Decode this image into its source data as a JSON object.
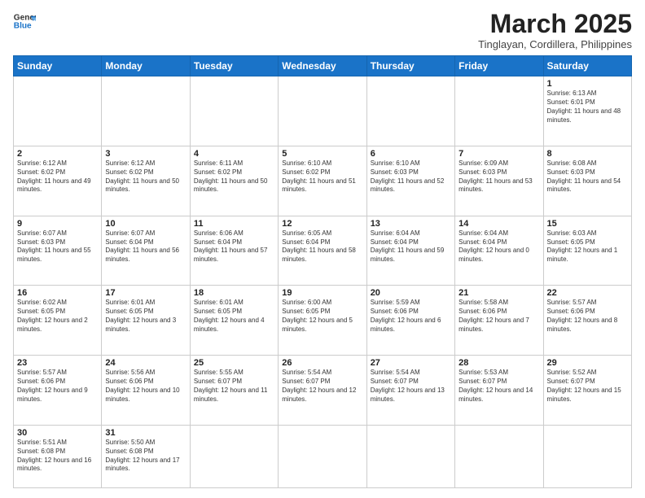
{
  "header": {
    "logo_general": "General",
    "logo_blue": "Blue",
    "title": "March 2025",
    "subtitle": "Tinglayan, Cordillera, Philippines"
  },
  "weekdays": [
    "Sunday",
    "Monday",
    "Tuesday",
    "Wednesday",
    "Thursday",
    "Friday",
    "Saturday"
  ],
  "weeks": [
    [
      {
        "day": "",
        "empty": true
      },
      {
        "day": "",
        "empty": true
      },
      {
        "day": "",
        "empty": true
      },
      {
        "day": "",
        "empty": true
      },
      {
        "day": "",
        "empty": true
      },
      {
        "day": "",
        "empty": true
      },
      {
        "day": "1",
        "rise": "6:13 AM",
        "set": "6:01 PM",
        "daylight": "11 hours and 48 minutes."
      }
    ],
    [
      {
        "day": "2",
        "rise": "6:12 AM",
        "set": "6:02 PM",
        "daylight": "11 hours and 49 minutes."
      },
      {
        "day": "3",
        "rise": "6:12 AM",
        "set": "6:02 PM",
        "daylight": "11 hours and 50 minutes."
      },
      {
        "day": "4",
        "rise": "6:11 AM",
        "set": "6:02 PM",
        "daylight": "11 hours and 50 minutes."
      },
      {
        "day": "5",
        "rise": "6:10 AM",
        "set": "6:02 PM",
        "daylight": "11 hours and 51 minutes."
      },
      {
        "day": "6",
        "rise": "6:10 AM",
        "set": "6:03 PM",
        "daylight": "11 hours and 52 minutes."
      },
      {
        "day": "7",
        "rise": "6:09 AM",
        "set": "6:03 PM",
        "daylight": "11 hours and 53 minutes."
      },
      {
        "day": "8",
        "rise": "6:08 AM",
        "set": "6:03 PM",
        "daylight": "11 hours and 54 minutes."
      }
    ],
    [
      {
        "day": "9",
        "rise": "6:07 AM",
        "set": "6:03 PM",
        "daylight": "11 hours and 55 minutes."
      },
      {
        "day": "10",
        "rise": "6:07 AM",
        "set": "6:04 PM",
        "daylight": "11 hours and 56 minutes."
      },
      {
        "day": "11",
        "rise": "6:06 AM",
        "set": "6:04 PM",
        "daylight": "11 hours and 57 minutes."
      },
      {
        "day": "12",
        "rise": "6:05 AM",
        "set": "6:04 PM",
        "daylight": "11 hours and 58 minutes."
      },
      {
        "day": "13",
        "rise": "6:04 AM",
        "set": "6:04 PM",
        "daylight": "11 hours and 59 minutes."
      },
      {
        "day": "14",
        "rise": "6:04 AM",
        "set": "6:04 PM",
        "daylight": "12 hours and 0 minutes."
      },
      {
        "day": "15",
        "rise": "6:03 AM",
        "set": "6:05 PM",
        "daylight": "12 hours and 1 minute."
      }
    ],
    [
      {
        "day": "16",
        "rise": "6:02 AM",
        "set": "6:05 PM",
        "daylight": "12 hours and 2 minutes."
      },
      {
        "day": "17",
        "rise": "6:01 AM",
        "set": "6:05 PM",
        "daylight": "12 hours and 3 minutes."
      },
      {
        "day": "18",
        "rise": "6:01 AM",
        "set": "6:05 PM",
        "daylight": "12 hours and 4 minutes."
      },
      {
        "day": "19",
        "rise": "6:00 AM",
        "set": "6:05 PM",
        "daylight": "12 hours and 5 minutes."
      },
      {
        "day": "20",
        "rise": "5:59 AM",
        "set": "6:06 PM",
        "daylight": "12 hours and 6 minutes."
      },
      {
        "day": "21",
        "rise": "5:58 AM",
        "set": "6:06 PM",
        "daylight": "12 hours and 7 minutes."
      },
      {
        "day": "22",
        "rise": "5:57 AM",
        "set": "6:06 PM",
        "daylight": "12 hours and 8 minutes."
      }
    ],
    [
      {
        "day": "23",
        "rise": "5:57 AM",
        "set": "6:06 PM",
        "daylight": "12 hours and 9 minutes."
      },
      {
        "day": "24",
        "rise": "5:56 AM",
        "set": "6:06 PM",
        "daylight": "12 hours and 10 minutes."
      },
      {
        "day": "25",
        "rise": "5:55 AM",
        "set": "6:07 PM",
        "daylight": "12 hours and 11 minutes."
      },
      {
        "day": "26",
        "rise": "5:54 AM",
        "set": "6:07 PM",
        "daylight": "12 hours and 12 minutes."
      },
      {
        "day": "27",
        "rise": "5:54 AM",
        "set": "6:07 PM",
        "daylight": "12 hours and 13 minutes."
      },
      {
        "day": "28",
        "rise": "5:53 AM",
        "set": "6:07 PM",
        "daylight": "12 hours and 14 minutes."
      },
      {
        "day": "29",
        "rise": "5:52 AM",
        "set": "6:07 PM",
        "daylight": "12 hours and 15 minutes."
      }
    ],
    [
      {
        "day": "30",
        "rise": "5:51 AM",
        "set": "6:08 PM",
        "daylight": "12 hours and 16 minutes."
      },
      {
        "day": "31",
        "rise": "5:50 AM",
        "set": "6:08 PM",
        "daylight": "12 hours and 17 minutes."
      },
      {
        "day": "",
        "empty": true
      },
      {
        "day": "",
        "empty": true
      },
      {
        "day": "",
        "empty": true
      },
      {
        "day": "",
        "empty": true
      },
      {
        "day": "",
        "empty": true
      }
    ]
  ],
  "labels": {
    "sunrise": "Sunrise:",
    "sunset": "Sunset:",
    "daylight": "Daylight:"
  }
}
